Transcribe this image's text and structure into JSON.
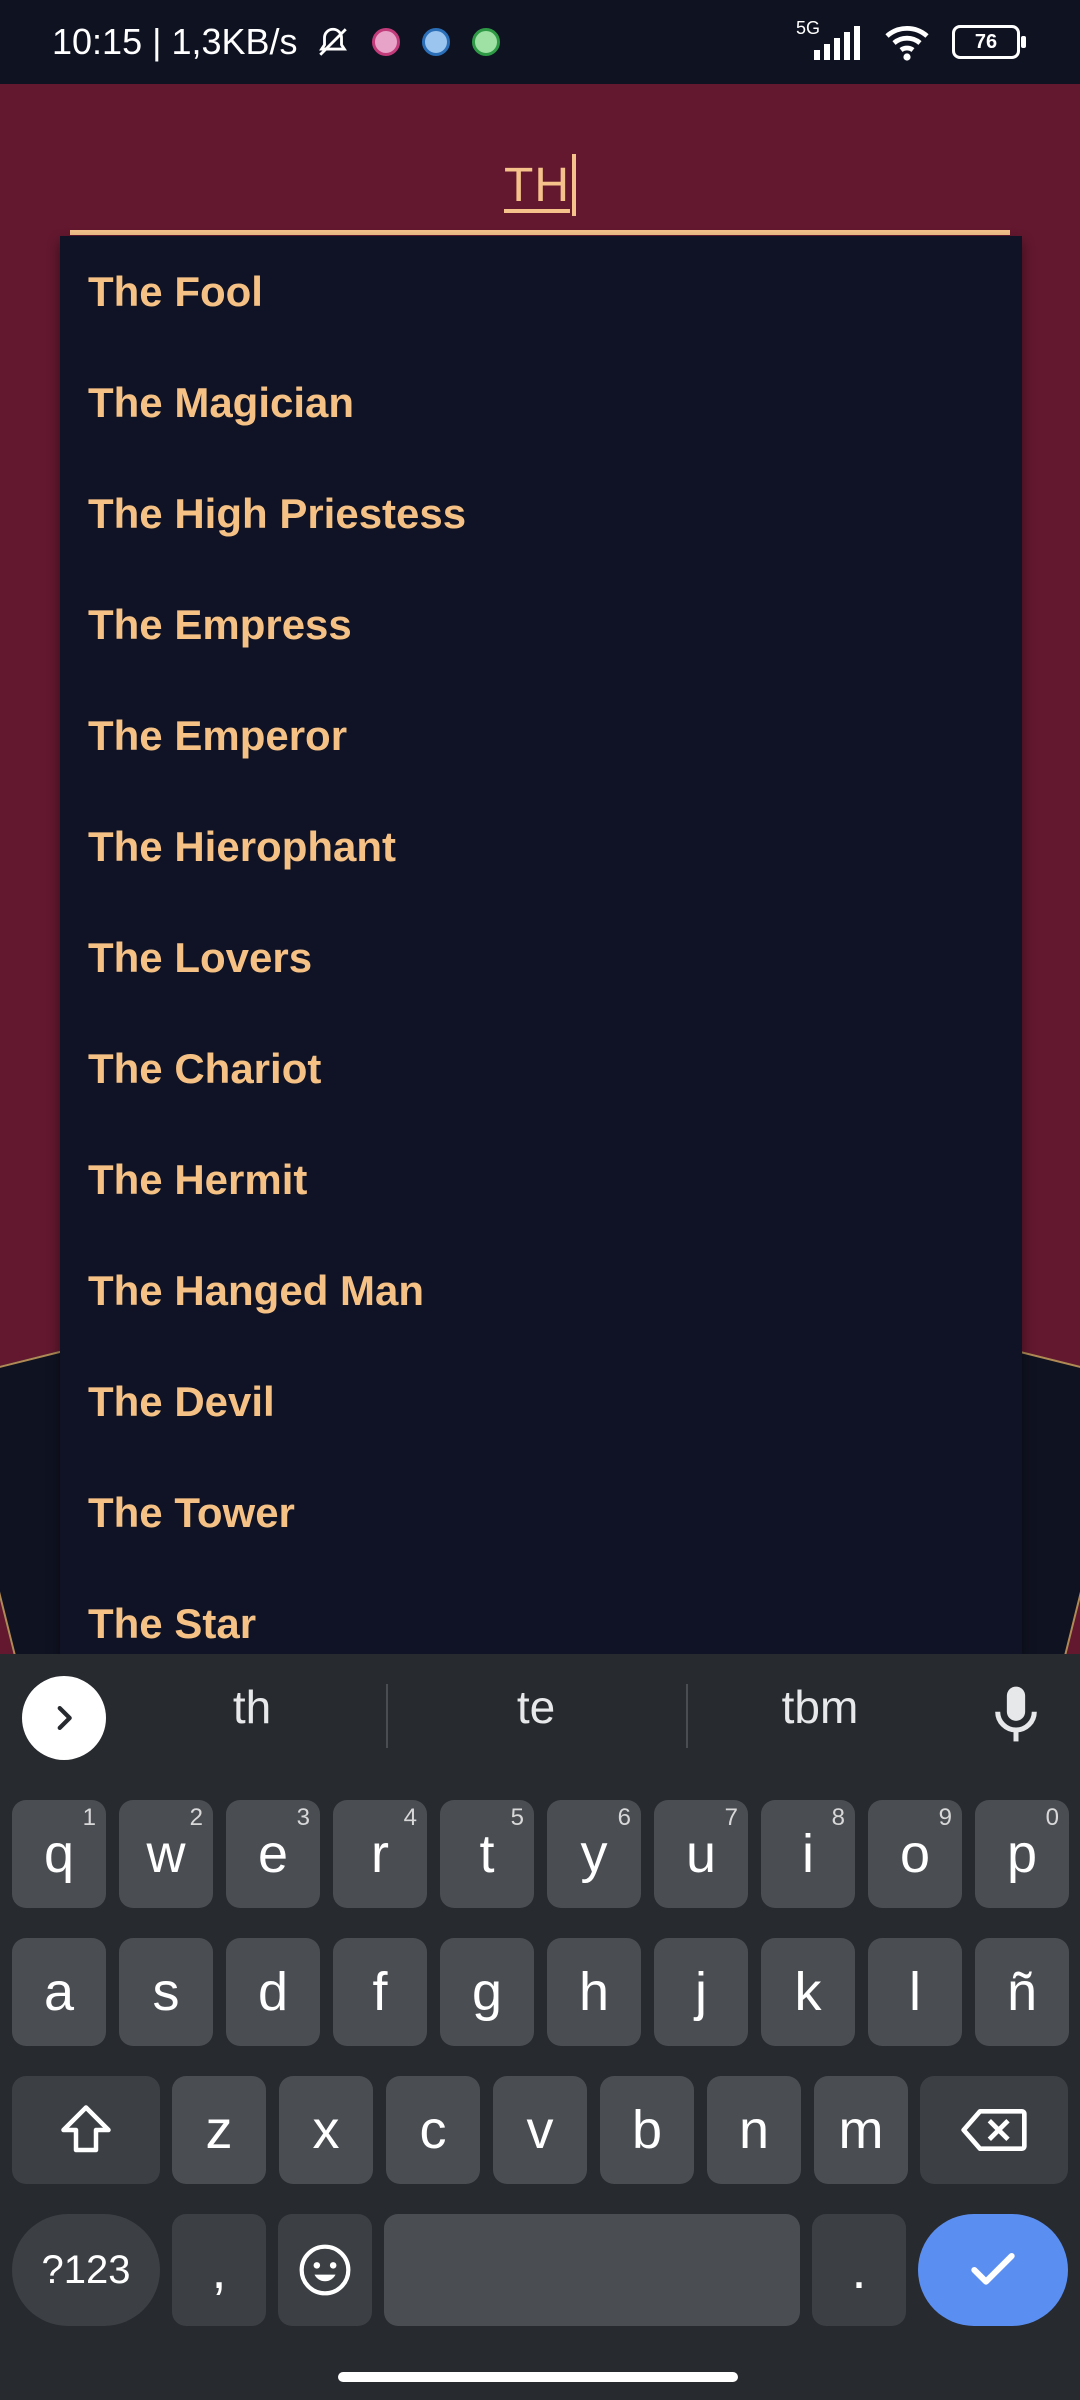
{
  "status_bar": {
    "time": "10:15",
    "speed": "| 1,3KB/s",
    "network": "5G",
    "battery": "76"
  },
  "search": {
    "value": "TH"
  },
  "suggestions": [
    "The Fool",
    "The Magician",
    "The High Priestess",
    "The Empress",
    "The Emperor",
    "The Hierophant",
    "The Lovers",
    "The Chariot",
    "The Hermit",
    "The Hanged Man",
    "The Devil",
    "The Tower",
    "The Star"
  ],
  "keyboard": {
    "word_suggestions": [
      "th",
      "te",
      "tbm"
    ],
    "row1": [
      {
        "k": "q",
        "h": "1"
      },
      {
        "k": "w",
        "h": "2"
      },
      {
        "k": "e",
        "h": "3"
      },
      {
        "k": "r",
        "h": "4"
      },
      {
        "k": "t",
        "h": "5"
      },
      {
        "k": "y",
        "h": "6"
      },
      {
        "k": "u",
        "h": "7"
      },
      {
        "k": "i",
        "h": "8"
      },
      {
        "k": "o",
        "h": "9"
      },
      {
        "k": "p",
        "h": "0"
      }
    ],
    "row2": [
      "a",
      "s",
      "d",
      "f",
      "g",
      "h",
      "j",
      "k",
      "l",
      "ñ"
    ],
    "row3": [
      "z",
      "x",
      "c",
      "v",
      "b",
      "n",
      "m"
    ],
    "symbols_label": "?123",
    "comma": ",",
    "period": "."
  },
  "colors": {
    "accent": "#f6c185",
    "background": "#63182f",
    "dropdown_bg": "#0f1325",
    "keyboard_bg": "#272a2e",
    "enter_key": "#5b8ef1"
  }
}
